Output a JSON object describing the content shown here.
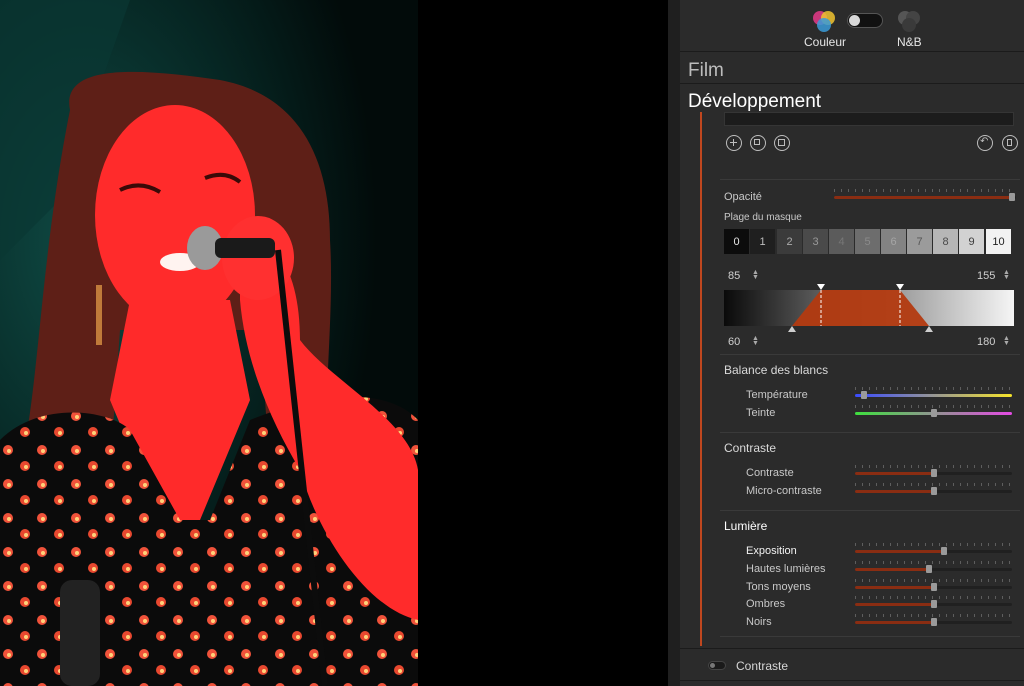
{
  "header": {
    "color_label": "Couleur",
    "bw_label": "N&B"
  },
  "sections": {
    "film": "Film",
    "development": "Développement"
  },
  "opacity": {
    "label": "Opacité",
    "value_fraction": 0.98
  },
  "mask_range": {
    "label": "Plage du masque",
    "boxes": [
      "0",
      "1",
      "2",
      "3",
      "4",
      "5",
      "6",
      "7",
      "8",
      "9",
      "10"
    ],
    "top_left": "85",
    "top_right": "155",
    "bottom_left": "60",
    "bottom_right": "180"
  },
  "white_balance": {
    "title": "Balance des blancs",
    "temperature": {
      "label": "Température",
      "value_fraction": 0.06
    },
    "tint": {
      "label": "Teinte",
      "value_fraction": 0.5
    }
  },
  "contrast_group": {
    "title": "Contraste",
    "contrast": {
      "label": "Contraste",
      "value_fraction": 0.5
    },
    "micro": {
      "label": "Micro-contraste",
      "value_fraction": 0.5
    }
  },
  "light": {
    "title": "Lumière",
    "exposure": {
      "label": "Exposition",
      "value_fraction": 0.57
    },
    "highlights": {
      "label": "Hautes lumières",
      "value_fraction": 0.47
    },
    "midtones": {
      "label": "Tons moyens",
      "value_fraction": 0.5
    },
    "shadows": {
      "label": "Ombres",
      "value_fraction": 0.5
    },
    "blacks": {
      "label": "Noirs",
      "value_fraction": 0.5
    }
  },
  "footer": {
    "label": "Contraste"
  },
  "colors": {
    "accent": "#c0471f",
    "panel": "#2b2b2b"
  }
}
